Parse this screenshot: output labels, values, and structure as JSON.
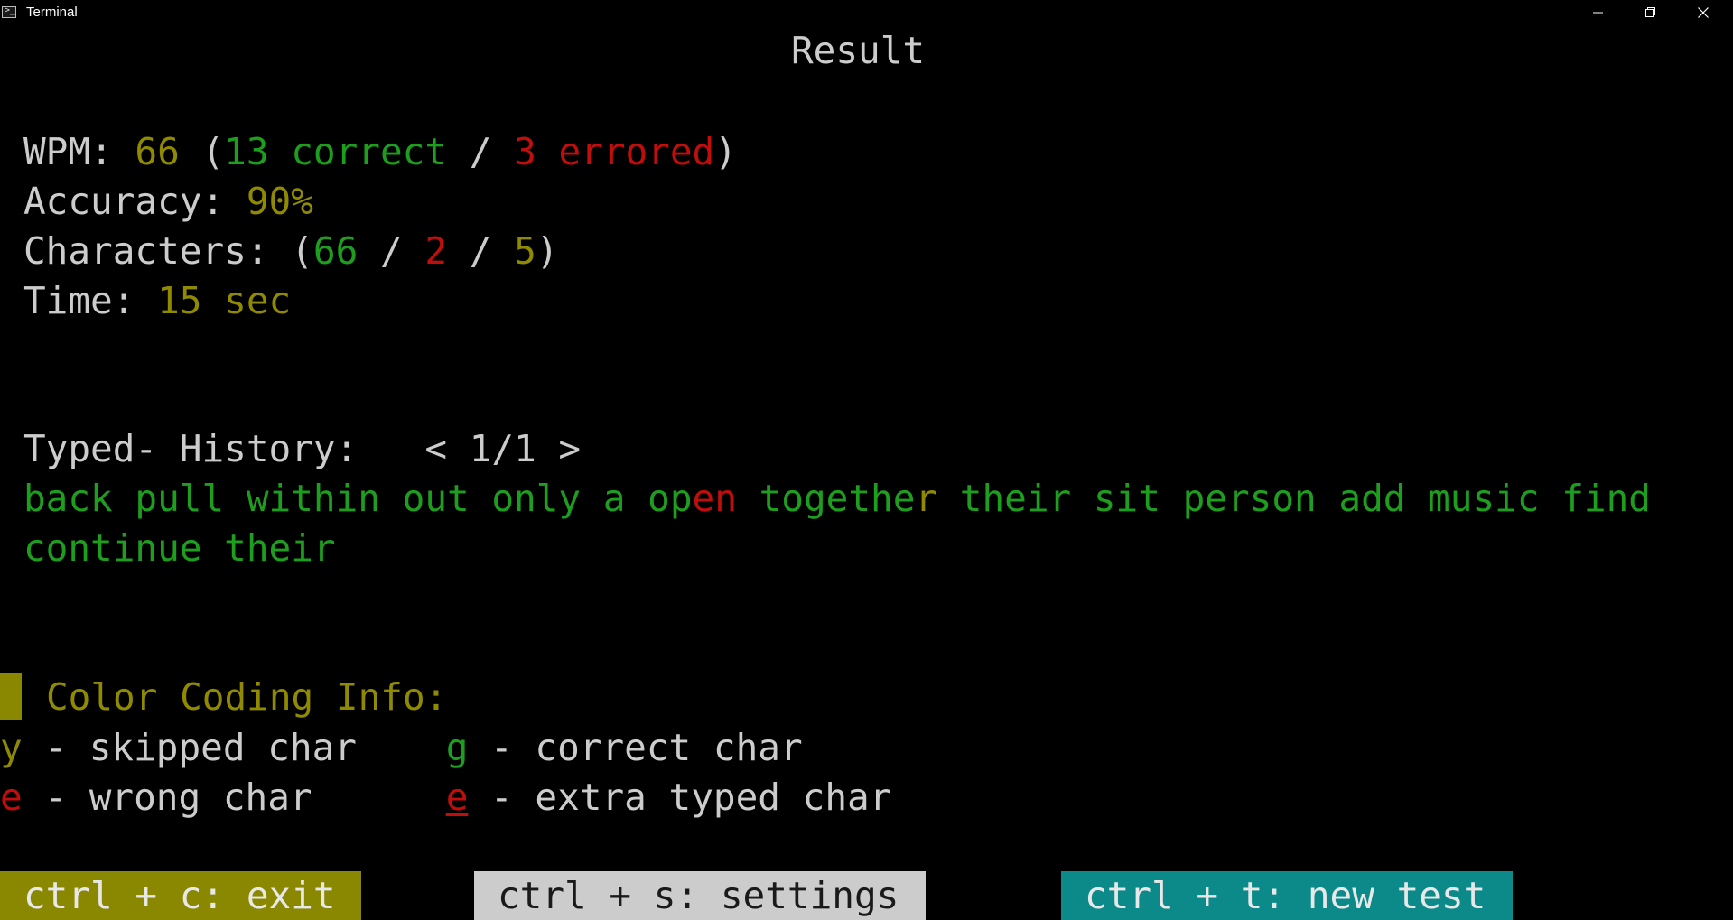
{
  "window": {
    "title": "Terminal",
    "icons": [
      "terminal-app-icon",
      "minimize-icon",
      "restore-icon",
      "close-icon"
    ]
  },
  "header": {
    "title": "Result"
  },
  "stats": {
    "wpm_label": "WPM: ",
    "wpm_value": "66",
    "wpm_open": " (",
    "correct_words": "13 correct",
    "sep": " / ",
    "errored_words": "3 errored",
    "wpm_close": ")",
    "accuracy_label": "Accuracy: ",
    "accuracy_value": "90%",
    "characters_label": "Characters: (",
    "chars_correct": "66",
    "chars_sep1": " / ",
    "chars_wrong": "2",
    "chars_sep2": " / ",
    "chars_skipped": "5",
    "chars_close": ")",
    "time_label": "Time: ",
    "time_value": "15 sec"
  },
  "history": {
    "label": "Typed- History:   ",
    "pager": "< 1/1 >",
    "line1_part1": "back pull within out only a op",
    "line1_wrong": "en",
    "line1_part2": " togethe",
    "line1_skipped": "r",
    "line1_part3": " their sit person add music find",
    "line2": "continue their"
  },
  "legend": {
    "title": "Color Coding Info:",
    "skipped_key": "y",
    "skipped_desc": " - skipped char    ",
    "correct_key": "g",
    "correct_desc": " - correct char",
    "wrong_key": "e",
    "wrong_desc": " - wrong char      ",
    "extra_key": "e",
    "extra_desc": " - extra typed char"
  },
  "footer": {
    "exit": "ctrl + c: exit",
    "settings": "ctrl + s: settings",
    "new_test": "ctrl + t: new test"
  },
  "colors": {
    "background": "#000000",
    "default_text": "#cccccc",
    "yellow": "#8f8a00",
    "green": "#1e9e1e",
    "red": "#c20d0d",
    "exit_bg": "#8a8700",
    "settings_bg": "#cccccc",
    "new_test_bg": "#0c8a8a"
  }
}
